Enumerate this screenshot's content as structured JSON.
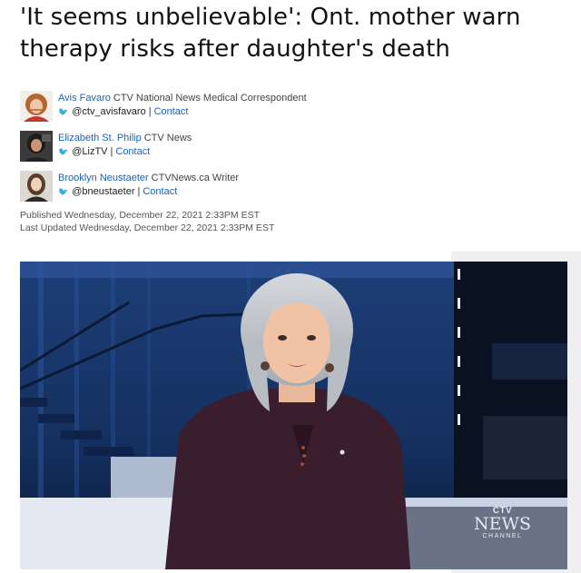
{
  "headline": {
    "line1": "'It seems unbelievable': Ont. mother warn",
    "line2": "therapy risks after daughter's death"
  },
  "authors": [
    {
      "name": "Avis Favaro",
      "role": "CTV National News Medical Correspondent",
      "twitter": "@ctv_avisfavaro",
      "contact": "Contact"
    },
    {
      "name": "Elizabeth St. Philip",
      "role": "CTV News",
      "twitter": "@LizTV",
      "contact": "Contact"
    },
    {
      "name": "Brooklyn Neustaeter",
      "role": "CTVNews.ca Writer",
      "twitter": "@bneustaeter",
      "contact": "Contact"
    }
  ],
  "dates": {
    "published": "Published Wednesday, December 22, 2021 2:33PM EST",
    "updated": "Last Updated Wednesday, December 22, 2021 2:33PM EST"
  },
  "video": {
    "logo_top": "CTV",
    "logo_main": "NEWS",
    "logo_sub": "CHANNEL"
  },
  "colors": {
    "link": "#1a63b8",
    "text": "#111111",
    "meta": "#555555"
  },
  "icons": {
    "twitter": "twitter-icon"
  }
}
